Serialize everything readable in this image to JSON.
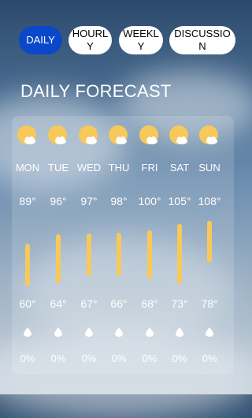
{
  "tabs": [
    {
      "label": "DAILY",
      "active": true
    },
    {
      "label": "HOURLY",
      "active": false
    },
    {
      "label": "WEEKLY",
      "active": false
    },
    {
      "label": "DISCUSSION",
      "active": false
    }
  ],
  "title": "DAILY FORECAST",
  "icons": {
    "weather": "partly-sunny-icon",
    "precip": "raindrop-icon"
  },
  "colors": {
    "active_tab": "#0b47c9",
    "sun": "#f7c95a"
  },
  "forecast": [
    {
      "day": "MON",
      "high": "89°",
      "low": "60°",
      "precip": "0%"
    },
    {
      "day": "TUE",
      "high": "96°",
      "low": "64°",
      "precip": "0%"
    },
    {
      "day": "WED",
      "high": "97°",
      "low": "67°",
      "precip": "0%"
    },
    {
      "day": "THU",
      "high": "98°",
      "low": "66°",
      "precip": "0%"
    },
    {
      "day": "FRI",
      "high": "100°",
      "low": "68°",
      "precip": "0%"
    },
    {
      "day": "SAT",
      "high": "105°",
      "low": "73°",
      "precip": "0%"
    },
    {
      "day": "SUN",
      "high": "108°",
      "low": "78°",
      "precip": "0%"
    }
  ]
}
